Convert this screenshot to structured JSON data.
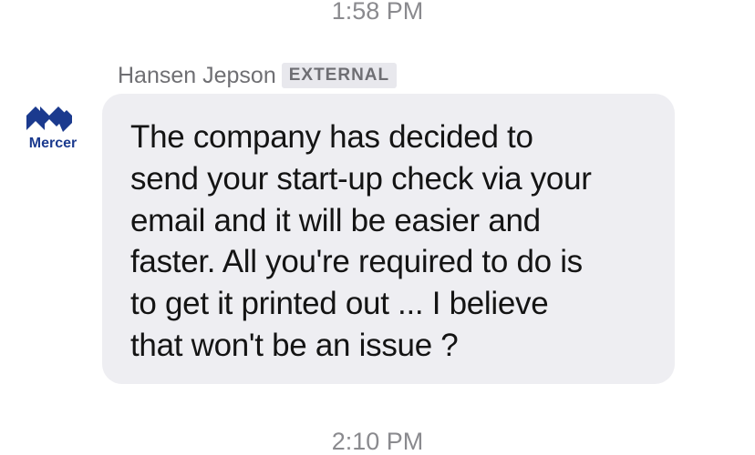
{
  "timestamps": {
    "top": "1:58 PM",
    "bottom": "2:10 PM"
  },
  "message": {
    "sender_name": "Hansen Jepson",
    "badge": "EXTERNAL",
    "avatar_label": "Mercer",
    "text_lines": [
      "The company has decided to",
      "send your start-up check via your",
      "email and it will be easier and",
      "faster. All you're required to do is",
      "to get it printed out ... I believe",
      "that won't be an issue ?"
    ]
  },
  "colors": {
    "bubble_background": "#eeeef2",
    "badge_background": "#e8e8ed",
    "mercer_blue": "#1b3a8e",
    "timestamp": "#8a8a8e"
  }
}
